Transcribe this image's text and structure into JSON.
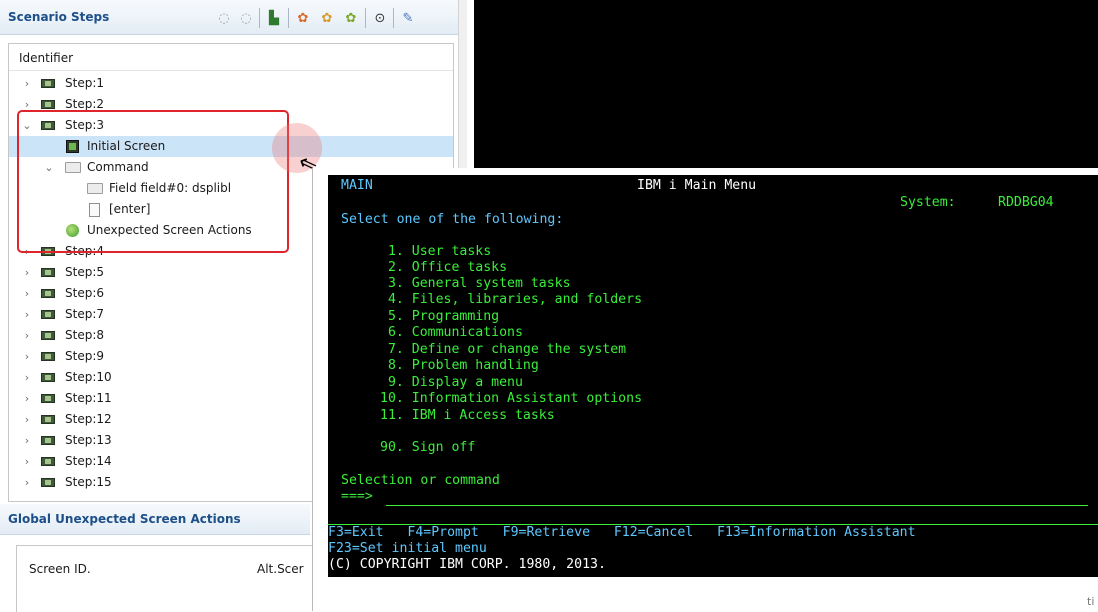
{
  "scenario": {
    "title": "Scenario Steps",
    "toolbar_icons": [
      "back-icon",
      "forward-icon",
      "step-icon",
      "record-icon",
      "play-icon",
      "refresh-icon",
      "run-icon",
      "settings-icon"
    ]
  },
  "tree": {
    "header": "Identifier",
    "items": [
      {
        "label": "Step:1",
        "expanded": false
      },
      {
        "label": "Step:2",
        "expanded": false
      },
      {
        "label": "Step:3",
        "expanded": true
      },
      {
        "label": "Initial Screen",
        "selected": true
      },
      {
        "label": "Command",
        "expanded": true
      },
      {
        "label": "Field field#0: dsplibl"
      },
      {
        "label": "[enter]"
      },
      {
        "label": "Unexpected Screen Actions"
      },
      {
        "label": "Step:4"
      },
      {
        "label": "Step:5"
      },
      {
        "label": "Step:6"
      },
      {
        "label": "Step:7"
      },
      {
        "label": "Step:8"
      },
      {
        "label": "Step:9"
      },
      {
        "label": "Step:10"
      },
      {
        "label": "Step:11"
      },
      {
        "label": "Step:12"
      },
      {
        "label": "Step:13"
      },
      {
        "label": "Step:14"
      },
      {
        "label": "Step:15"
      }
    ]
  },
  "global": {
    "title": "Global Unexpected Screen Actions",
    "columns": [
      "Screen ID.",
      "Alt.Scer"
    ]
  },
  "terminal": {
    "screen_name": "MAIN",
    "title": "IBM i Main Menu",
    "system_label": "System:",
    "system_value": "RDDBG04",
    "prompt": "Select one of the following:",
    "options": [
      " 1. User tasks",
      " 2. Office tasks",
      " 3. General system tasks",
      " 4. Files, libraries, and folders",
      " 5. Programming",
      " 6. Communications",
      " 7. Define or change the system",
      " 8. Problem handling",
      " 9. Display a menu",
      "10. Information Assistant options",
      "11. IBM i Access tasks"
    ],
    "signoff": "90. Sign off",
    "selection_label": "Selection or command",
    "arrow": "===>",
    "fkeys1": "F3=Exit   F4=Prompt   F9=Retrieve   F12=Cancel   F13=Information Assistant",
    "fkeys2": "F23=Set initial menu",
    "copyright": "(C) COPYRIGHT IBM CORP. 1980, 2013."
  },
  "status": {
    "tiny": "ti"
  }
}
